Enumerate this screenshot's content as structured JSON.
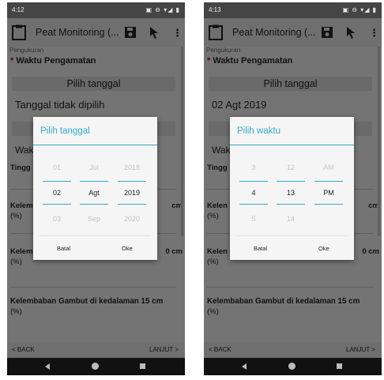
{
  "screens": [
    {
      "status": {
        "time": "4:12",
        "icons": "▣ ⊖ ▾◢ ▮"
      },
      "app_title": "Peat Monitoring (...",
      "section": "Pengukuran",
      "field_label": "Waktu Pengamatan",
      "required_mark": "*",
      "pick_date_label": "Pilih tanggal",
      "date_value": "Tanggal tidak dipilih",
      "waktu_partial": "Wak",
      "tinggi_partial": "Tingg",
      "kel_partial": "Kelem",
      "kel_unit": "(%)",
      "cm_text": "cm",
      "cm_text2": "0 cm",
      "kel_full": "Kelembaban Gambut di kedalaman 15 cm",
      "back": "< BACK",
      "next": "LANJUT >",
      "dialog": {
        "title": "Pilih tanggal",
        "columns": [
          {
            "prev": "01",
            "current": "02",
            "next": "03"
          },
          {
            "prev": "Jul",
            "current": "Agt",
            "next": "Sep"
          },
          {
            "prev": "2018",
            "current": "2019",
            "next": "2020"
          }
        ],
        "cancel": "Batal",
        "ok": "Oke"
      }
    },
    {
      "status": {
        "time": "4:13",
        "icons": "▣ ⊖ ▾◢ ▮"
      },
      "app_title": "Peat Monitoring (...",
      "section": "Pengukuran",
      "field_label": "Waktu Pengamatan",
      "required_mark": "*",
      "pick_date_label": "Pilih tanggal",
      "date_value": "02 Agt 2019",
      "waktu_partial": "Wak",
      "tinggi_partial": "Tingg",
      "kel_partial": "Kelen",
      "kel_unit": "(%)",
      "cm_text": "cm",
      "cm_text2": "0 cm",
      "kel_full": "Kelembaban Gambut di kedalaman 15 cm",
      "back": "< BACK",
      "next": "LANJUT >",
      "dialog": {
        "title": "Pilih waktu",
        "columns": [
          {
            "prev": "3",
            "current": "4",
            "next": "5"
          },
          {
            "prev": "12",
            "current": "13",
            "next": "14"
          },
          {
            "prev": "AM",
            "current": "PM",
            "next": ""
          }
        ],
        "cancel": "Batal",
        "ok": "Oke"
      }
    }
  ]
}
